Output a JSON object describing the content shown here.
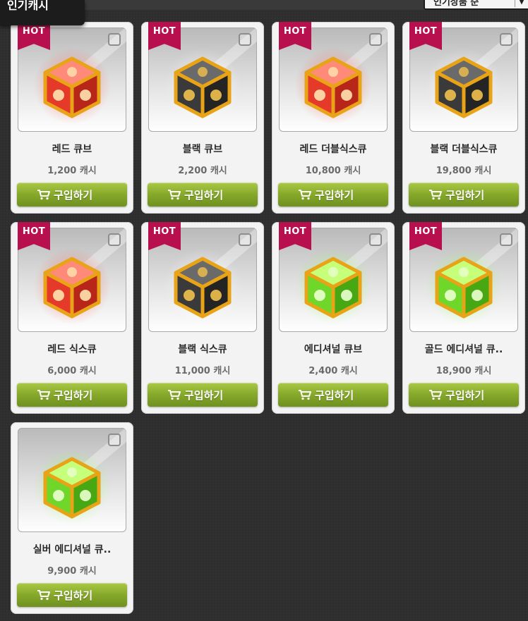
{
  "header": {
    "category_tab": "인기캐시",
    "sort_label": "인기상품 순"
  },
  "colors": {
    "hot": "#b8104f",
    "buy_button": "#86a82a",
    "red_cube": "#e53a2a",
    "black_cube": "#3a3a3a",
    "green_cube": "#6fd62a",
    "gold_frame": "#e8a317"
  },
  "items": [
    {
      "name": "레드 큐브",
      "price": "1,200 캐시",
      "hot": "HOT",
      "cube": "red",
      "buy": "구입하기",
      "icon": "red-cube-icon"
    },
    {
      "name": "블랙 큐브",
      "price": "2,200 캐시",
      "hot": "HOT",
      "cube": "black",
      "buy": "구입하기",
      "icon": "black-cube-icon"
    },
    {
      "name": "레드 더블식스큐",
      "price": "10,800 캐시",
      "hot": "HOT",
      "cube": "red",
      "buy": "구입하기",
      "icon": "red-cube-icon"
    },
    {
      "name": "블랙 더블식스큐",
      "price": "19,800 캐시",
      "hot": "HOT",
      "cube": "black",
      "buy": "구입하기",
      "icon": "black-cube-icon"
    },
    {
      "name": "레드 식스큐",
      "price": "6,000 캐시",
      "hot": "HOT",
      "cube": "red",
      "buy": "구입하기",
      "icon": "red-cube-icon"
    },
    {
      "name": "블랙 식스큐",
      "price": "11,000 캐시",
      "hot": "HOT",
      "cube": "black",
      "buy": "구입하기",
      "icon": "black-cube-icon"
    },
    {
      "name": "에디셔널 큐브",
      "price": "2,400 캐시",
      "hot": "HOT",
      "cube": "green",
      "buy": "구입하기",
      "icon": "green-cube-icon"
    },
    {
      "name": "골드 에디셔널 큐..",
      "price": "18,900 캐시",
      "hot": "HOT",
      "cube": "green",
      "buy": "구입하기",
      "icon": "green-cube-icon"
    },
    {
      "name": "실버 에디셔널 큐..",
      "price": "9,900 캐시",
      "hot": "",
      "cube": "green",
      "buy": "구입하기",
      "icon": "green-cube-icon"
    }
  ]
}
